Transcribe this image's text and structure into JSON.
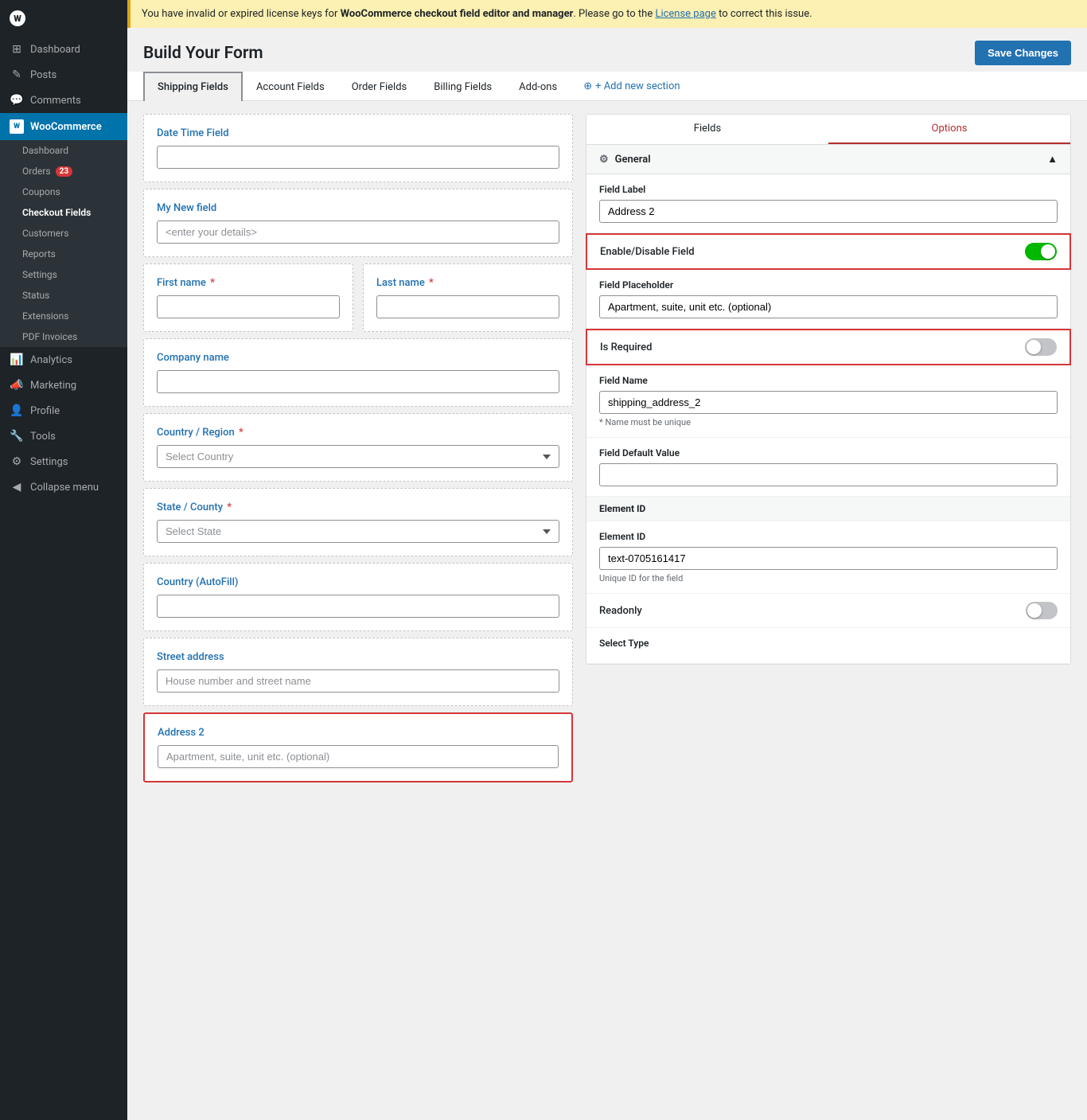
{
  "sidebar": {
    "logo": "W",
    "items": [
      {
        "id": "dashboard",
        "label": "Dashboard",
        "icon": "⊞"
      },
      {
        "id": "posts",
        "label": "Posts",
        "icon": "✎"
      },
      {
        "id": "comments",
        "label": "Comments",
        "icon": "💬"
      },
      {
        "id": "woocommerce",
        "label": "WooCommerce",
        "icon": "W",
        "active": true
      },
      {
        "id": "woo-dashboard",
        "label": "Dashboard",
        "sub": true
      },
      {
        "id": "woo-orders",
        "label": "Orders",
        "sub": true,
        "badge": "23"
      },
      {
        "id": "woo-coupons",
        "label": "Coupons",
        "sub": true
      },
      {
        "id": "woo-checkout",
        "label": "Checkout Fields",
        "sub": true,
        "active": true
      },
      {
        "id": "woo-customers",
        "label": "Customers",
        "sub": true
      },
      {
        "id": "woo-reports",
        "label": "Reports",
        "sub": true
      },
      {
        "id": "woo-settings",
        "label": "Settings",
        "sub": true
      },
      {
        "id": "woo-status",
        "label": "Status",
        "sub": true
      },
      {
        "id": "woo-extensions",
        "label": "Extensions",
        "sub": true
      },
      {
        "id": "woo-pdf",
        "label": "PDF Invoices",
        "sub": true
      },
      {
        "id": "analytics",
        "label": "Analytics",
        "icon": "📊"
      },
      {
        "id": "marketing",
        "label": "Marketing",
        "icon": "📣"
      },
      {
        "id": "profile",
        "label": "Profile",
        "icon": "👤"
      },
      {
        "id": "tools",
        "label": "Tools",
        "icon": "🔧"
      },
      {
        "id": "settings",
        "label": "Settings",
        "icon": "⚙"
      },
      {
        "id": "collapse",
        "label": "Collapse menu",
        "icon": "◀"
      }
    ]
  },
  "page": {
    "title": "Build Your Form",
    "save_button": "Save Changes"
  },
  "notice": {
    "text_before": "You have invalid or expired license keys for ",
    "product": "WooCommerce checkout field editor and manager",
    "text_middle": ". Please go to the ",
    "link_text": "License page",
    "text_after": " to correct this issue."
  },
  "tabs": [
    {
      "id": "shipping",
      "label": "Shipping Fields",
      "active": true
    },
    {
      "id": "account",
      "label": "Account Fields"
    },
    {
      "id": "order",
      "label": "Order Fields"
    },
    {
      "id": "billing",
      "label": "Billing Fields"
    },
    {
      "id": "addons",
      "label": "Add-ons"
    },
    {
      "id": "add-section",
      "label": "+ Add new section"
    }
  ],
  "form_fields": [
    {
      "id": "datetime",
      "label": "Date Time Field",
      "type": "input",
      "placeholder": ""
    },
    {
      "id": "my-new-field",
      "label": "My New field",
      "type": "input",
      "placeholder": "<enter your details>"
    },
    {
      "id": "name-row",
      "type": "row",
      "fields": [
        {
          "id": "first-name",
          "label": "First name",
          "required": true,
          "type": "input",
          "placeholder": ""
        },
        {
          "id": "last-name",
          "label": "Last name",
          "required": true,
          "type": "input",
          "placeholder": ""
        }
      ]
    },
    {
      "id": "company",
      "label": "Company name",
      "type": "input",
      "placeholder": ""
    },
    {
      "id": "country-region",
      "label": "Country / Region",
      "required": true,
      "type": "select",
      "placeholder": "Select Country"
    },
    {
      "id": "state-county",
      "label": "State / County",
      "required": true,
      "type": "select",
      "placeholder": "Select State"
    },
    {
      "id": "country-autofill",
      "label": "Country (AutoFill)",
      "type": "input",
      "placeholder": ""
    },
    {
      "id": "street-address",
      "label": "Street address",
      "type": "input",
      "placeholder": "House number and street name"
    },
    {
      "id": "address2",
      "label": "Address 2",
      "type": "input",
      "placeholder": "Apartment, suite, unit etc. (optional)",
      "highlighted": true
    }
  ],
  "right_panel": {
    "tabs": [
      {
        "id": "fields",
        "label": "Fields"
      },
      {
        "id": "options",
        "label": "Options",
        "active": true
      }
    ],
    "section_label": "General",
    "fields": {
      "field_label": {
        "label": "Field Label",
        "value": "Address 2"
      },
      "enable_disable": {
        "label": "Enable/Disable Field",
        "enabled": true
      },
      "field_placeholder": {
        "label": "Field Placeholder",
        "value": "Apartment, suite, unit etc. (optional)"
      },
      "is_required": {
        "label": "Is Required",
        "enabled": false
      },
      "field_name": {
        "label": "Field Name",
        "value": "shipping_address_2",
        "help": "* Name must be unique"
      },
      "field_default": {
        "label": "Field Default Value",
        "value": ""
      },
      "element_id_section": "Element ID",
      "element_id": {
        "label": "Element ID",
        "value": "text-0705161417",
        "help": "Unique ID for the field"
      },
      "readonly": {
        "label": "Readonly",
        "enabled": false
      },
      "select_type": {
        "label": "Select Type",
        "value": ""
      }
    }
  }
}
